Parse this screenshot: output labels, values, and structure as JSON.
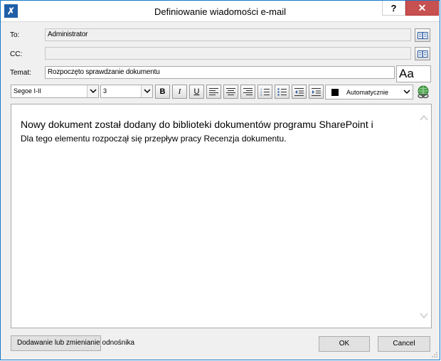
{
  "window": {
    "title": "Definiowanie wiadomości e-mail",
    "help_label": "?",
    "close_label": "✕"
  },
  "form": {
    "to_label": "To:",
    "to_value": "Administrator",
    "cc_label": "CC:",
    "cc_value": "",
    "subject_label": "Temat:",
    "subject_value": "Rozpoczęto sprawdzanie dokumentu",
    "aa_label": "Aa"
  },
  "toolbar": {
    "font_name": "Segoe I-II",
    "font_size": "3",
    "bold": "B",
    "italic": "I",
    "underline": "U",
    "color_label": "Automatycznie",
    "color_value": "#000000"
  },
  "body": {
    "line1": "Nowy dokument został dodany do biblioteki dokumentów programu SharePoint i",
    "line2": "Dla tego elementu rozpoczął się przepływ pracy Recenzja dokumentu."
  },
  "buttons": {
    "link": "Dodawanie lub zmienianie odnośnika",
    "ok": "OK",
    "cancel": "Cancel"
  },
  "icons": {
    "app": "tools-icon",
    "address_book": "address-book-icon",
    "hyperlink": "globe-link-icon"
  }
}
